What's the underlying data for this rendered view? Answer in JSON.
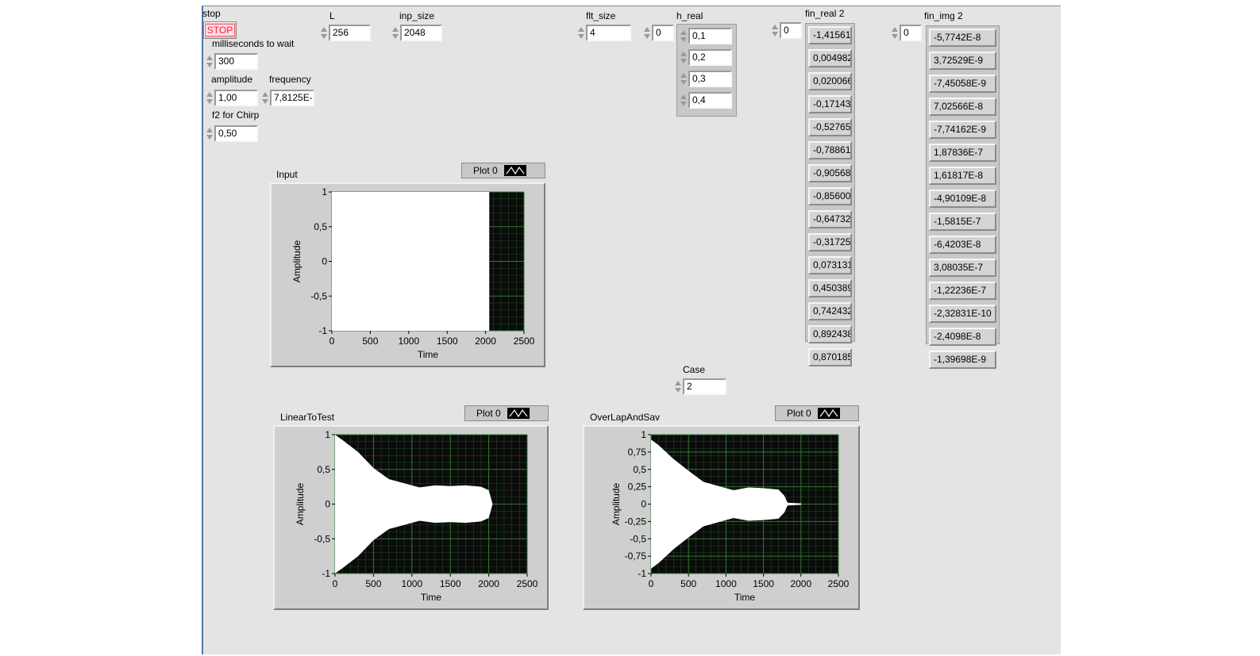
{
  "stop": {
    "label": "stop",
    "button": "STOP"
  },
  "ms_wait": {
    "label": "milliseconds to wait",
    "value": "300"
  },
  "amplitude": {
    "label": "amplitude",
    "value": "1,00"
  },
  "frequency": {
    "label": "frequency",
    "value": "7,8125E-"
  },
  "f2": {
    "label": "f2 for Chirp",
    "value": "0,50"
  },
  "L": {
    "label": "L",
    "value": "256"
  },
  "inp_size": {
    "label": "inp_size",
    "value": "2048"
  },
  "flt_size": {
    "label": "flt_size",
    "value": "4"
  },
  "h_real": {
    "label": "h_real",
    "index": "0",
    "values": [
      "0,1",
      "0,2",
      "0,3",
      "0,4"
    ]
  },
  "fin_real": {
    "label": "fin_real 2",
    "index": "0",
    "values": [
      "-1,41561",
      "0,004982",
      "0,020066",
      "-0,17143",
      "-0,52765",
      "-0,78861",
      "-0,90568",
      "-0,85600",
      "-0,64732",
      "-0,31725",
      "0,073131",
      "0,450389",
      "0,742432",
      "0,892438",
      "0,870185"
    ]
  },
  "fin_img": {
    "label": "fin_img 2",
    "index": "0",
    "values": [
      "-5,7742E-8",
      "3,72529E-9",
      "-7,45058E-9",
      "7,02566E-8",
      "-7,74162E-9",
      "1,87836E-7",
      "1,61817E-8",
      "-4,90109E-8",
      "-1,5815E-7",
      "-6,4203E-8",
      "3,08035E-7",
      "-1,22236E-7",
      "-2,32831E-10",
      "-2,4098E-8",
      "-1,39698E-9"
    ]
  },
  "case": {
    "label": "Case",
    "value": "2"
  },
  "graphs": {
    "input": {
      "title": "Input",
      "legend": "Plot 0",
      "xlabel": "Time",
      "ylabel": "Amplitude"
    },
    "linear": {
      "title": "LinearToTest",
      "legend": "Plot 0",
      "xlabel": "Time",
      "ylabel": "Amplitude"
    },
    "overlap": {
      "title": "OverLapAndSav",
      "legend": "Plot 0",
      "xlabel": "Time",
      "ylabel": "Amplitude"
    }
  },
  "chart_data": [
    {
      "type": "area",
      "title": "Input",
      "xlabel": "Time",
      "ylabel": "Amplitude",
      "xlim": [
        0,
        2500
      ],
      "ylim": [
        -1,
        1
      ],
      "x_ticks": [
        "0",
        "500",
        "1000",
        "1500",
        "2000",
        "2500"
      ],
      "y_ticks": [
        "1",
        "0,5",
        "0",
        "-0,5",
        "-1"
      ],
      "series": [
        {
          "x": [
            0,
            2048
          ],
          "y": [
            1,
            1
          ],
          "envelope_lower": [
            -1,
            -1
          ]
        }
      ]
    },
    {
      "type": "area",
      "title": "LinearToTest",
      "xlabel": "Time",
      "ylabel": "Amplitude",
      "xlim": [
        0,
        2500
      ],
      "ylim": [
        -1,
        1
      ],
      "x_ticks": [
        "0",
        "500",
        "1000",
        "1500",
        "2000",
        "2500"
      ],
      "y_ticks": [
        "1",
        "0,5",
        "0",
        "-0,5",
        "-1"
      ],
      "series": [
        {
          "x": [
            0,
            100,
            300,
            500,
            700,
            900,
            1100,
            1300,
            1500,
            1700,
            1900,
            2000,
            2050
          ],
          "y": [
            1,
            0.92,
            0.75,
            0.52,
            0.36,
            0.3,
            0.24,
            0.27,
            0.26,
            0.27,
            0.25,
            0.2,
            0.0
          ]
        }
      ]
    },
    {
      "type": "area",
      "title": "OverLapAndSav",
      "xlabel": "Time",
      "ylabel": "Amplitude",
      "xlim": [
        0,
        2500
      ],
      "ylim": [
        -1,
        1
      ],
      "x_ticks": [
        "0",
        "500",
        "1000",
        "1500",
        "2000",
        "2500"
      ],
      "y_ticks": [
        "1",
        "0,75",
        "0,5",
        "0,25",
        "0",
        "-0,25",
        "-0,5",
        "-0,75",
        "-1"
      ],
      "series": [
        {
          "x": [
            0,
            100,
            300,
            500,
            700,
            900,
            1100,
            1300,
            1500,
            1700,
            1780,
            1820,
            2000
          ],
          "y": [
            0.93,
            0.85,
            0.65,
            0.48,
            0.32,
            0.26,
            0.2,
            0.24,
            0.23,
            0.21,
            0.12,
            0.02,
            0.01
          ]
        }
      ]
    }
  ]
}
